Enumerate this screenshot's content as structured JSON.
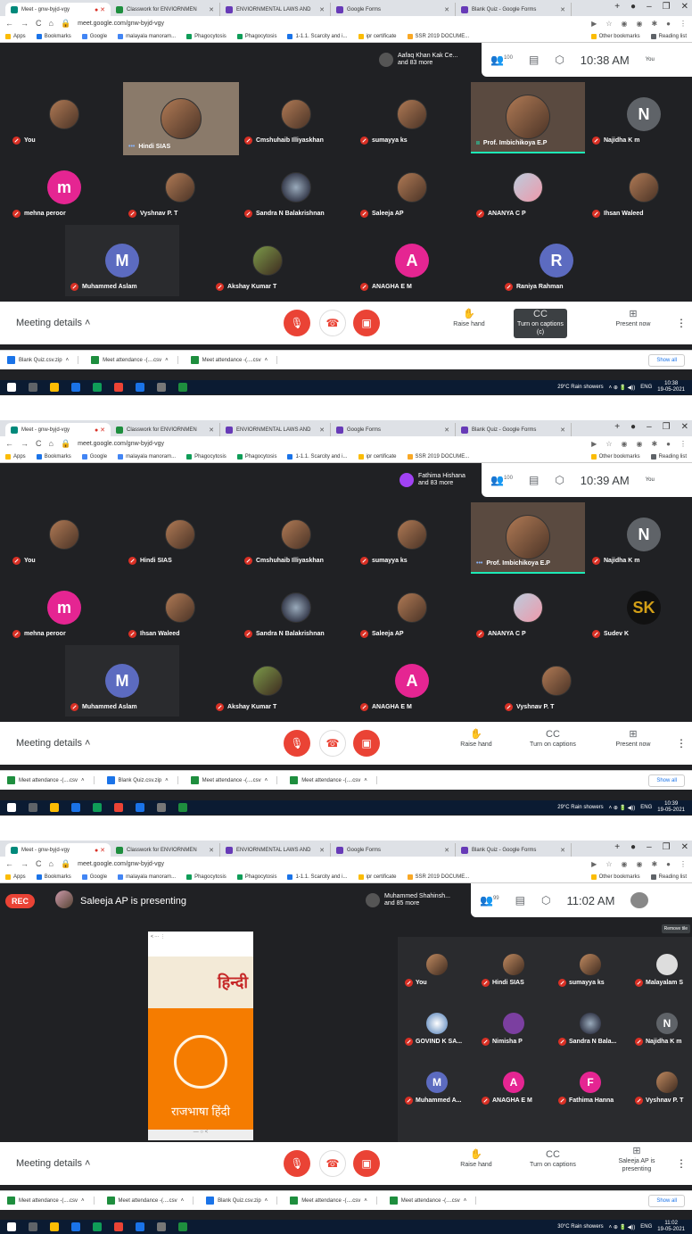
{
  "browser": {
    "tabs": [
      "Meet - gnw-byjd-vgy",
      "Classwork for ENVIORNMEN",
      "ENVIORNMENTAL LAWS AND",
      "Google Forms",
      "Blank Quiz - Google Forms"
    ],
    "url": "meet.google.com/gnw-byjd-vgy",
    "bookmarks": [
      "Apps",
      "Bookmarks",
      "Google",
      "malayala manoram...",
      "Phagocytosis",
      "Phagocytosis",
      "1-1.1. Scarcity and i...",
      "ipr certificate",
      "SSR 2019 DOCUME...",
      "Other bookmarks",
      "Reading list"
    ]
  },
  "meeting": {
    "details_label": "Meeting details",
    "raise_hand": "Raise hand",
    "captions": "Turn on captions",
    "captions_tooltip": "Turn on captions (c)",
    "present_now": "Present now",
    "rec": "REC"
  },
  "downloads": {
    "show_all": "Show all"
  },
  "taskbar": {
    "weather1": "29°C Rain showers",
    "weather3": "30°C Rain showers",
    "lang": "ENG",
    "date": "19-05-2021"
  },
  "shot1": {
    "time": "10:38 AM",
    "participants_badge": "100",
    "stack_name": "Aafaq Khan Kak Ce...",
    "stack_more": "and 83 more",
    "you": "You",
    "clock": "10:38",
    "downloads": [
      "Blank Quiz.csv.zip",
      "Meet attendance -(....csv",
      "Meet attendance -(....csv"
    ],
    "tiles": [
      "You",
      "Hindi SIAS",
      "Cmshuhaib Illiyaskhan",
      "sumayya ks",
      "Prof. Imbichikoya E.P",
      "Najidha K m",
      "mehna peroor",
      "Vyshnav P. T",
      "Sandra N Balakrishnan",
      "Saleeja AP",
      "ANANYA C P",
      "Ihsan Waleed",
      "Muhammed Aslam",
      "Akshay Kumar T",
      "ANAGHA E M",
      "Raniya Rahman"
    ]
  },
  "shot2": {
    "time": "10:39 AM",
    "participants_badge": "100",
    "stack_name": "Fathima Hishana",
    "stack_more": "and 83 more",
    "you": "You",
    "clock": "10:39",
    "downloads": [
      "Meet attendance -(....csv",
      "Blank Quiz.csv.zip",
      "Meet attendance -(....csv",
      "Meet attendance -(....csv"
    ],
    "tiles": [
      "You",
      "Hindi SIAS",
      "Cmshuhaib Illiyaskhan",
      "sumayya ks",
      "Prof. Imbichikoya E.P",
      "Najidha K m",
      "mehna peroor",
      "Ihsan Waleed",
      "Sandra N Balakrishnan",
      "Saleeja AP",
      "ANANYA C P",
      "Sudev K",
      "Muhammed Aslam",
      "Akshay Kumar T",
      "ANAGHA E M",
      "Vyshnav P. T"
    ]
  },
  "shot3": {
    "time": "11:02 AM",
    "participants_badge": "99",
    "stack_name": "Muhammed Shahinsh...",
    "stack_more": "and 85 more",
    "presenting": "Saleeja AP is presenting",
    "present_btn": "Saleeja AP is presenting",
    "tooltip": "Remove tile",
    "clock": "11:02",
    "slide_text1": "हिन्दी",
    "slide_text2": "राजभाषा हिंदी",
    "downloads": [
      "Meet attendance -(....csv",
      "Meet attendance -(....csv",
      "Blank Quiz.csv.zip",
      "Meet attendance -(....csv",
      "Meet attendance -(....csv"
    ],
    "tiles": [
      "You",
      "Hindi SIAS",
      "sumayya ks",
      "Malayalam S",
      "GOVIND K SA...",
      "Nimisha P",
      "Sandra N Bala...",
      "Najidha K m",
      "Muhammed A...",
      "ANAGHA E M",
      "Fathima Hanna",
      "Vyshnav P. T"
    ]
  },
  "colors": {
    "meet_bg": "#202124",
    "red": "#ea4335",
    "pink": "#e52592",
    "purple": "#5c6bc0",
    "gray": "#5f6368"
  }
}
